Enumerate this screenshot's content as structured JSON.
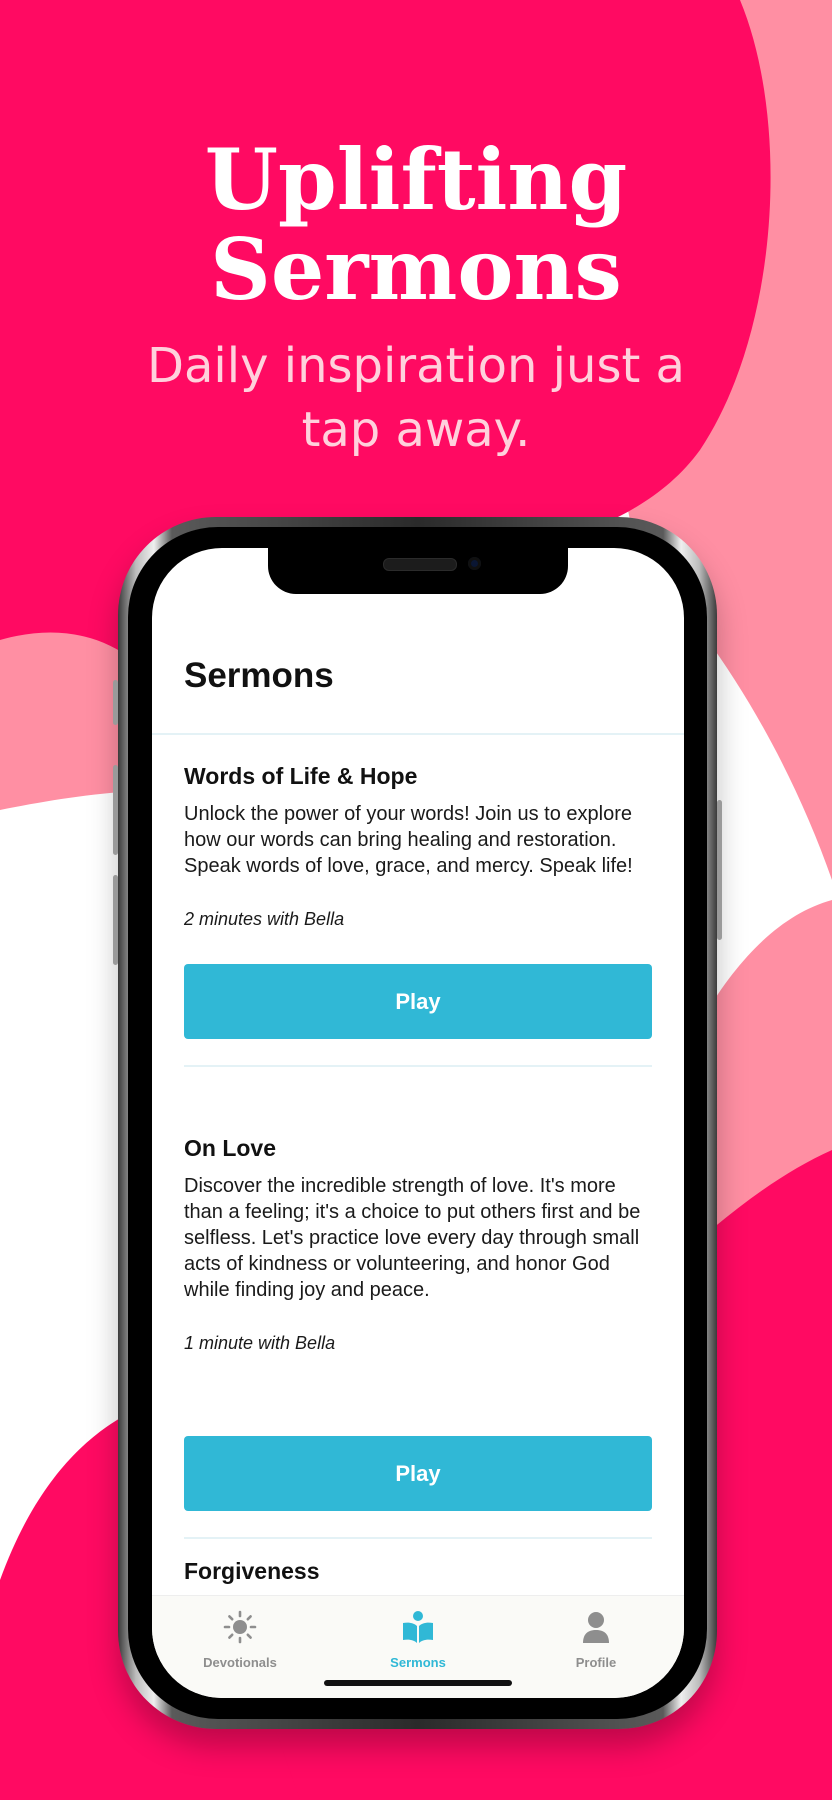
{
  "colors": {
    "brand_pink": "#ff0a62",
    "light_pink": "#ff8fa3",
    "accent_blue": "#30b8d6",
    "inactive_gray": "#8e8e8e"
  },
  "hero": {
    "title_line1": "Uplifting",
    "title_line2": "Sermons",
    "subtitle_line1": "Daily inspiration just a",
    "subtitle_line2": "tap away."
  },
  "screen": {
    "title": "Sermons"
  },
  "sermons": [
    {
      "title": "Words of Life & Hope",
      "description": "Unlock the power of your words! Join us to explore how our words can bring healing and restoration. Speak words of love, grace, and mercy. Speak life!",
      "meta": "2 minutes with Bella",
      "button_label": "Play"
    },
    {
      "title": "On Love",
      "description": "Discover the incredible strength of love. It's more than a feeling; it's a choice to put others first and be selfless. Let's practice love every day through small acts of kindness or volunteering, and honor God while finding joy and peace.",
      "meta": "1 minute with Bella",
      "button_label": "Play"
    },
    {
      "title": "Forgiveness"
    }
  ],
  "tabbar": {
    "items": [
      {
        "label": "Devotionals",
        "icon": "sun-icon",
        "active": false
      },
      {
        "label": "Sermons",
        "icon": "book-reader-icon",
        "active": true
      },
      {
        "label": "Profile",
        "icon": "person-icon",
        "active": false
      }
    ]
  }
}
